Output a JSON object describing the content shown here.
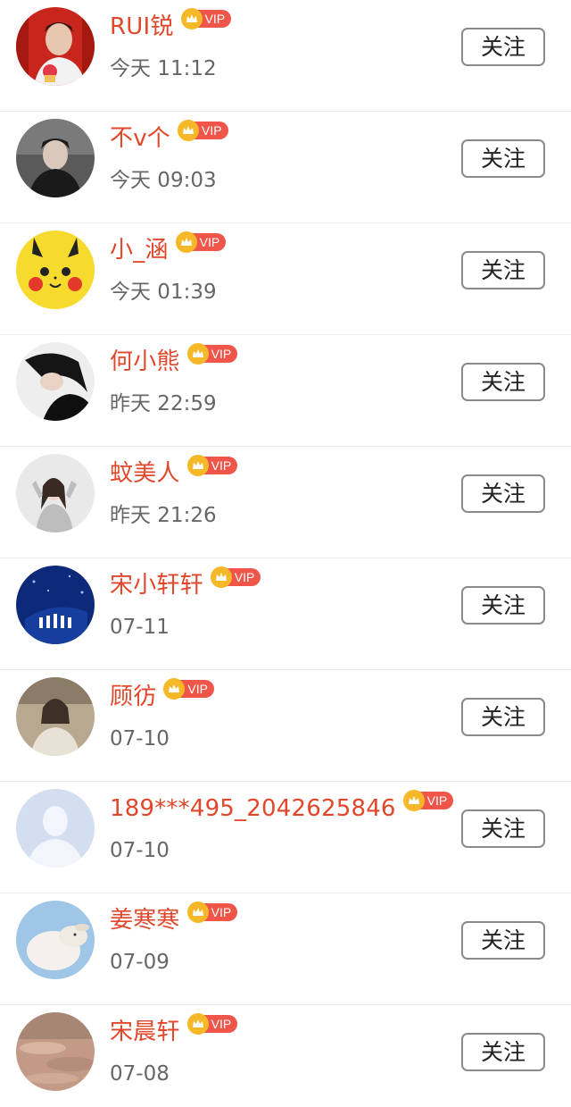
{
  "items": [
    {
      "name": "RUI锐",
      "time": "今天 11:12",
      "vip": "VIP",
      "follow": "关注",
      "avatar": "avatar-red-portrait"
    },
    {
      "name": "不v个",
      "time": "今天 09:03",
      "vip": "VIP",
      "follow": "关注",
      "avatar": "avatar-dark-portrait"
    },
    {
      "name": "小_涵",
      "time": "今天 01:39",
      "vip": "VIP",
      "follow": "关注",
      "avatar": "avatar-pikachu"
    },
    {
      "name": "何小熊",
      "time": "昨天 22:59",
      "vip": "VIP",
      "follow": "关注",
      "avatar": "avatar-dark-girl"
    },
    {
      "name": "蚊美人",
      "time": "昨天 21:26",
      "vip": "VIP",
      "follow": "关注",
      "avatar": "avatar-light-girl"
    },
    {
      "name": "宋小轩轩",
      "time": "07-11",
      "vip": "VIP",
      "follow": "关注",
      "avatar": "avatar-blue-stage"
    },
    {
      "name": "顾彷",
      "time": "07-10",
      "vip": "VIP",
      "follow": "关注",
      "avatar": "avatar-beige-portrait"
    },
    {
      "name": "189***495_2042625846",
      "time": "07-10",
      "vip": "VIP",
      "follow": "关注",
      "avatar": "avatar-default-user"
    },
    {
      "name": "姜寒寒",
      "time": "07-09",
      "vip": "VIP",
      "follow": "关注",
      "avatar": "avatar-sheep"
    },
    {
      "name": "宋晨轩",
      "time": "07-08",
      "vip": "VIP",
      "follow": "关注",
      "avatar": "avatar-sunset-sky"
    }
  ],
  "colors": {
    "name": "#e0472b",
    "vip_crown": "#f5b829",
    "vip_tag": "#f0554a",
    "time": "#666666",
    "button_border": "#8a8a8a"
  }
}
